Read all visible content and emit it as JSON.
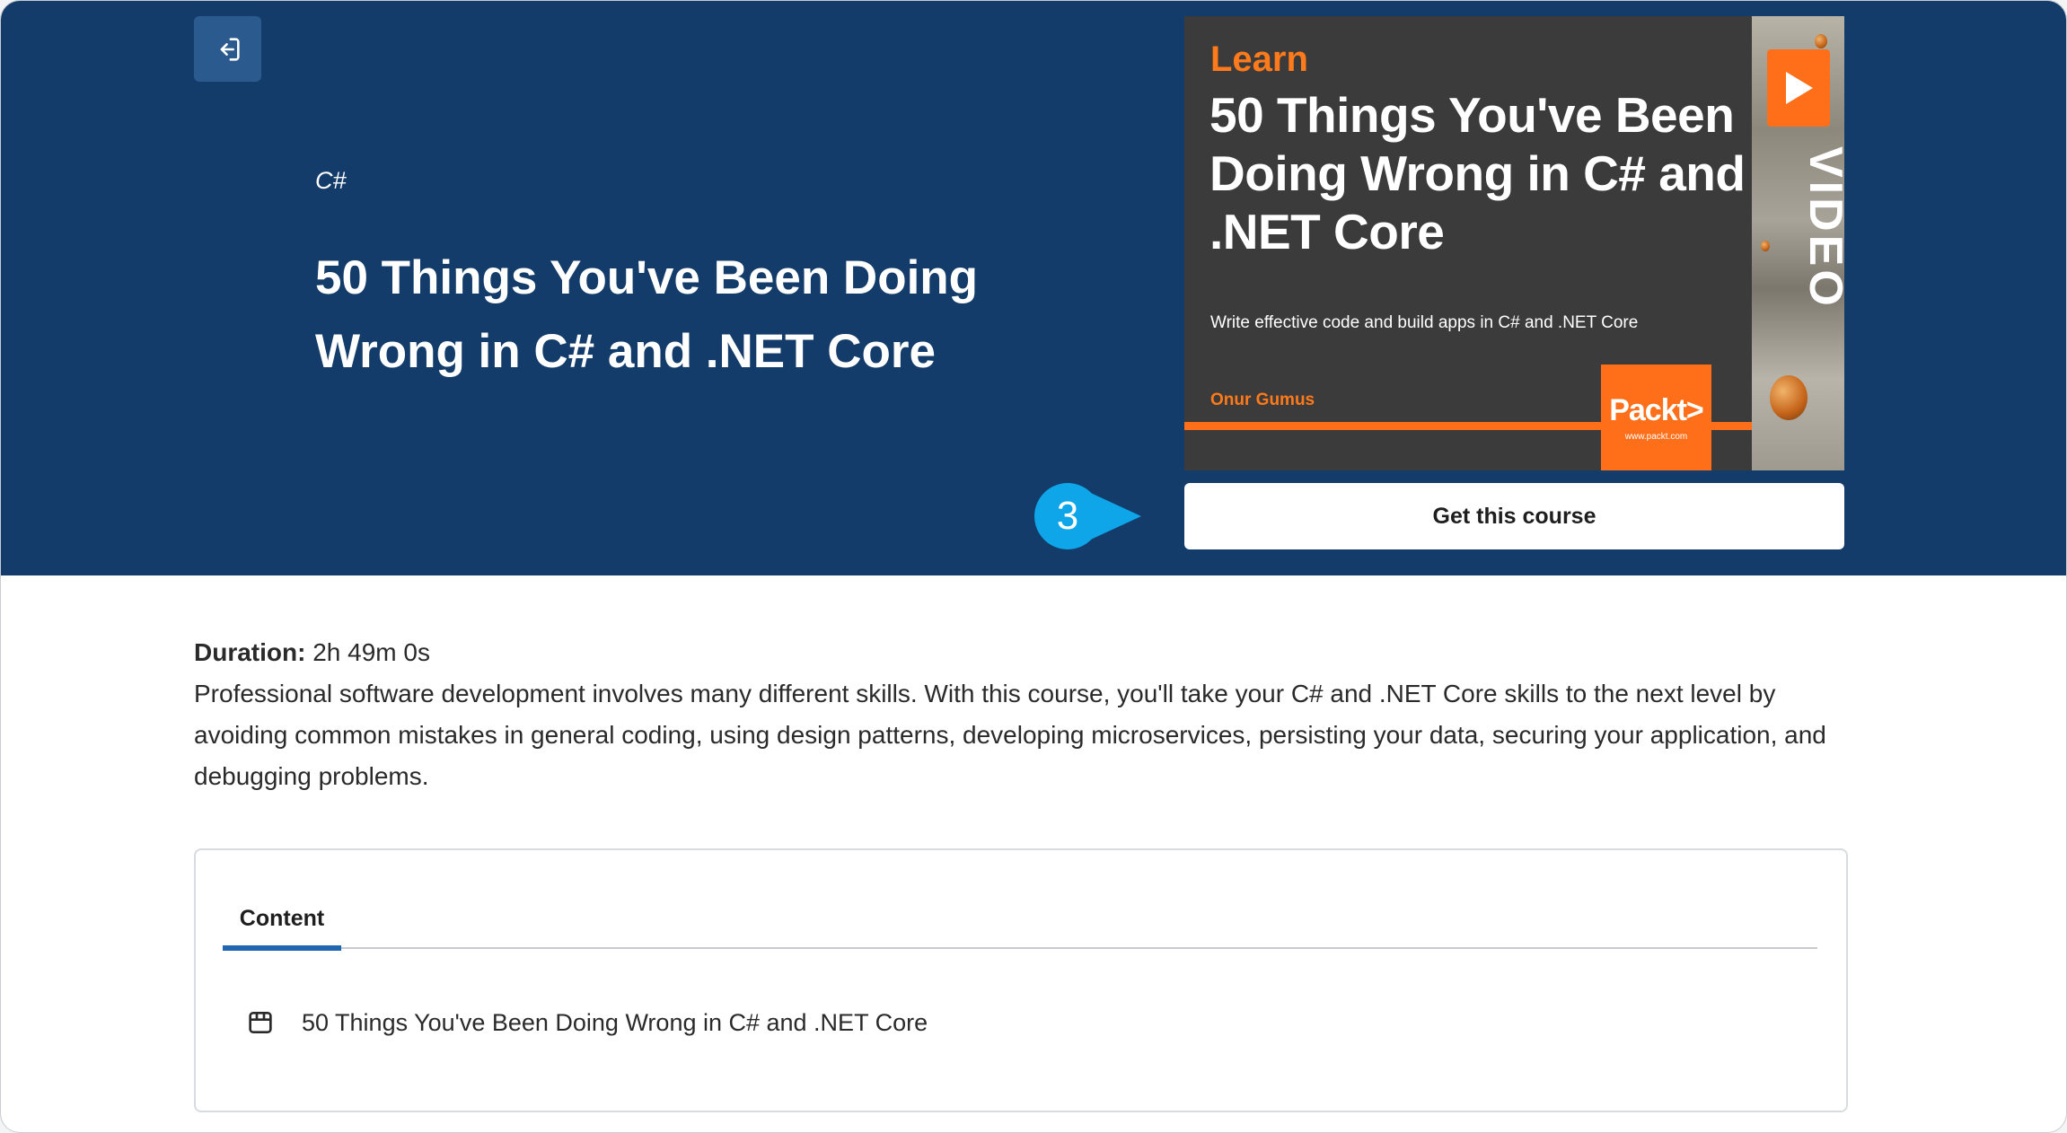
{
  "header": {
    "back_icon": "logout-arrow-icon",
    "category": "C#",
    "title": "50 Things You've Been Doing Wrong in C# and .NET Core"
  },
  "cover": {
    "learn": "Learn",
    "title": "50 Things You've Been Doing Wrong in C# and .NET Core",
    "subtitle": "Write effective code and build apps in C# and .NET Core",
    "author": "Onur Gumus",
    "publisher": "Packt>",
    "publisher_url": "www.packt.com",
    "format_label": "VIDEO",
    "play_icon": "play-icon",
    "accent_color": "#ff6f1a"
  },
  "cta": {
    "label": "Get this course"
  },
  "annotation": {
    "step_number": "3",
    "color": "#0ea5e9"
  },
  "details": {
    "duration_label": "Duration:",
    "duration_value": "2h 49m 0s",
    "description": "Professional software development involves many different skills. With this course, you'll take your C# and .NET Core skills to the next level by avoiding common mistakes in general coding, using design patterns, developing microservices, persisting your data, securing your application, and debugging problems."
  },
  "content_panel": {
    "tabs": [
      {
        "label": "Content",
        "active": true
      }
    ],
    "items": [
      {
        "icon": "box-icon",
        "label": "50 Things You've Been Doing Wrong in C# and .NET Core"
      }
    ]
  },
  "colors": {
    "hero_background": "#133c6a",
    "tab_accent": "#1f67b0"
  }
}
